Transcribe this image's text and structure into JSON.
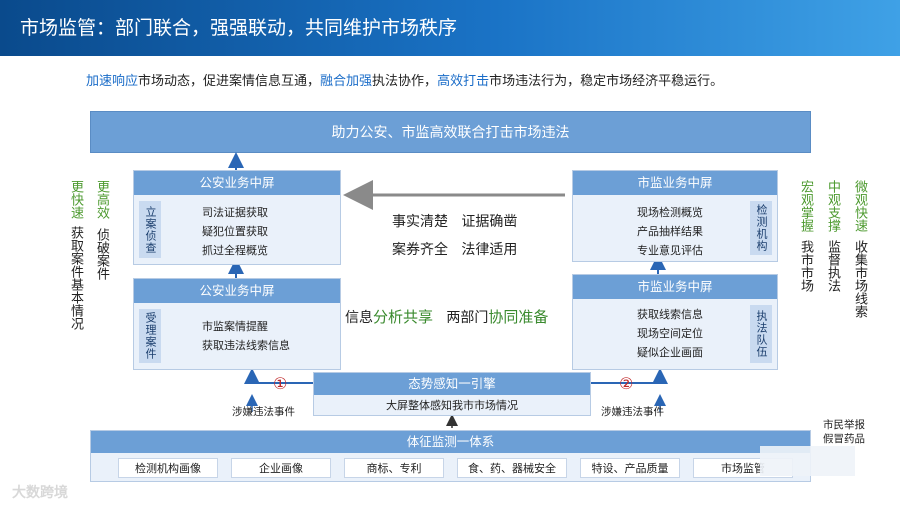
{
  "title": "市场监管：部门联合，强强联动，共同维护市场秩序",
  "subtitle": {
    "p1": "加速响应",
    "p2": "市场动态，促进案情信息互通，",
    "p3": "融合加强",
    "p4": "执法协作，",
    "p5": "高效打击",
    "p6": "市场违法行为，稳定市场经济平稳运行。"
  },
  "top_banner": "助力公安、市监高效联合打击市场违法",
  "left_upper": {
    "head": "公安业务中屏",
    "tag": "立案侦查",
    "items": [
      "司法证据获取",
      "疑犯位置获取",
      "抓过全程概览"
    ]
  },
  "left_lower": {
    "head": "公安业务中屏",
    "tag": "受理案件",
    "items": [
      "市监案情提醒",
      "获取违法线索信息"
    ]
  },
  "right_upper": {
    "head": "市监业务中屏",
    "tag": "检测机构",
    "items": [
      "现场检测概览",
      "产品抽样结果",
      "专业意见评估"
    ]
  },
  "right_lower": {
    "head": "市监业务中屏",
    "tag": "执法队伍",
    "items": [
      "获取线索信息",
      "现场空间定位",
      "疑似企业画面"
    ]
  },
  "center": {
    "line1a": "事实清楚",
    "line1b": "证据确凿",
    "line2a": "案券齐全",
    "line2b": "法律适用",
    "line3a": "信息",
    "line3b": "分析共享",
    "line3c": "两部门",
    "line3d": "协同准备"
  },
  "situation": {
    "head": "态势感知一引擎",
    "body": "大屏整体感知我市市场情况"
  },
  "markers": {
    "one": "①",
    "two": "②"
  },
  "event_label_left": "涉嫌违法事件",
  "event_label_right": "涉嫌违法事件",
  "left_cols": {
    "c1_green": "更快速",
    "c1_black": "获取案件基本情况",
    "c2_green": "更高效",
    "c2_black": "侦破案件"
  },
  "right_cols": {
    "c1_green": "宏观掌握",
    "c1_black": "我市市场",
    "c2_green": "中观支撑",
    "c2_black": "监督执法",
    "c3_green": "微观快速",
    "c3_black": "收集市场线索"
  },
  "bottom": {
    "head": "体征监测一体系",
    "chips": [
      "检测机构画像",
      "企业画像",
      "商标、专利",
      "食、药、器械安全",
      "特设、产品质量",
      "市场监管"
    ]
  },
  "side_note": [
    "市民举报",
    "假冒药品"
  ],
  "watermark": "大数跨境",
  "colors": {
    "accent": "#1a6cc8",
    "green": "#3a8a2e",
    "panel_head": "#6c9fd6",
    "arrow": "#c0282a"
  }
}
